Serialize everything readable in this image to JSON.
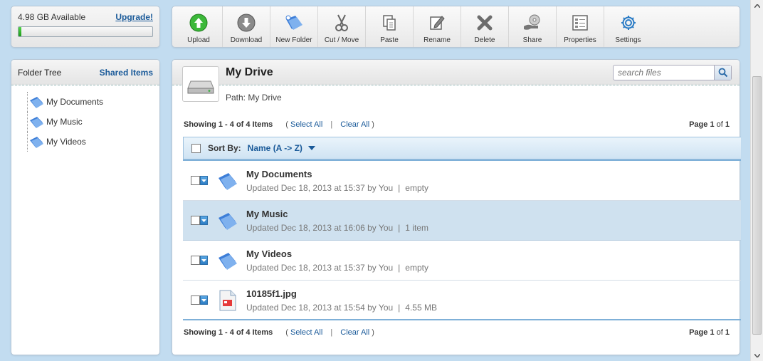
{
  "storage": {
    "available_label": "4.98 GB Available",
    "upgrade_label": "Upgrade!",
    "used_fraction": 0.01,
    "bar_color": "#2fb52a"
  },
  "toolbar": {
    "buttons": [
      {
        "label": "Upload",
        "icon": "upload-icon"
      },
      {
        "label": "Download",
        "icon": "download-icon"
      },
      {
        "label": "New Folder",
        "icon": "new-folder-icon"
      },
      {
        "label": "Cut / Move",
        "icon": "scissors-icon"
      },
      {
        "label": "Paste",
        "icon": "paste-icon"
      },
      {
        "label": "Rename",
        "icon": "rename-icon"
      },
      {
        "label": "Delete",
        "icon": "delete-icon"
      },
      {
        "label": "Share",
        "icon": "share-icon"
      },
      {
        "label": "Properties",
        "icon": "properties-icon"
      },
      {
        "label": "Settings",
        "icon": "gear-icon"
      }
    ]
  },
  "tree": {
    "title": "Folder Tree",
    "shared_label": "Shared Items",
    "items": [
      {
        "label": "My Documents"
      },
      {
        "label": "My Music"
      },
      {
        "label": "My Videos"
      }
    ]
  },
  "main": {
    "title": "My Drive",
    "path_label": "Path:",
    "path_value": "My Drive",
    "search_placeholder": "search files",
    "showing": "Showing 1 - 4 of 4 Items",
    "select_all": "Select All",
    "clear_all": "Clear All",
    "open_paren": "(",
    "close_paren": ")",
    "pipe": "|",
    "page_label": "Page",
    "page_current": "1",
    "page_of": "of",
    "page_total": "1",
    "sort_label": "Sort By:",
    "sort_value": "Name (A -> Z)",
    "items": [
      {
        "name": "My Documents",
        "updated": "Updated Dec 18, 2013 at 15:37 by You",
        "detail": "empty",
        "type": "folder",
        "selected": false
      },
      {
        "name": "My Music",
        "updated": "Updated Dec 18, 2013 at 16:06 by You",
        "detail": "1 item",
        "type": "folder",
        "selected": true
      },
      {
        "name": "My Videos",
        "updated": "Updated Dec 18, 2013 at 15:37 by You",
        "detail": "empty",
        "type": "folder",
        "selected": false
      },
      {
        "name": "10185f1.jpg",
        "updated": "Updated Dec 18, 2013 at 15:54 by You",
        "detail": "4.55 MB",
        "type": "image",
        "selected": false
      }
    ]
  },
  "colors": {
    "link": "#1a5a99",
    "selected_row": "#cfe1ef",
    "background": "#c2dcf0"
  }
}
